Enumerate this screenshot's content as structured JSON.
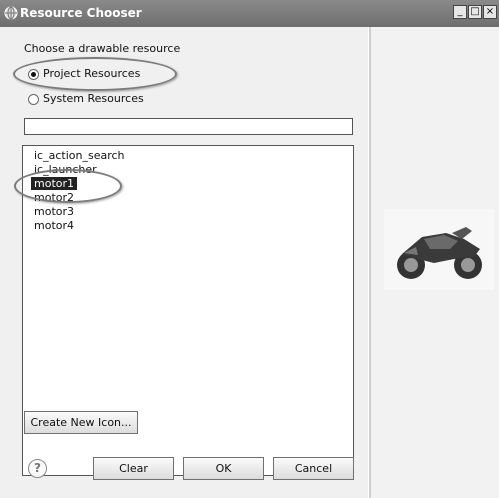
{
  "window": {
    "title": "Resource Chooser",
    "minimize_glyph": "_",
    "maximize_glyph": "□",
    "close_glyph": "×"
  },
  "chooser": {
    "prompt": "Choose a drawable resource",
    "radio_project": "Project Resources",
    "radio_system": "System Resources",
    "selected_radio": "Project Resources",
    "filter_value": ""
  },
  "resources": {
    "items": [
      "ic_action_search",
      "ic_launcher",
      "motor1",
      "motor2",
      "motor3",
      "motor4"
    ],
    "selected": "motor1"
  },
  "buttons": {
    "create_icon": "Create New Icon...",
    "help": "?",
    "clear": "Clear",
    "ok": "OK",
    "cancel": "Cancel"
  },
  "preview": {
    "image": "motorcycle-preview"
  },
  "colors": {
    "titlebar": "#7a7a7a",
    "annotation_ellipse": "#7c7c7c",
    "selection": "#222222"
  }
}
